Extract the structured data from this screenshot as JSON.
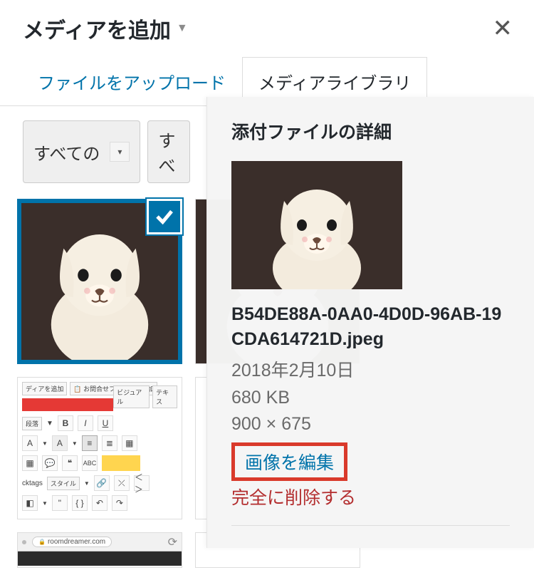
{
  "header": {
    "title": "メディアを追加"
  },
  "tabs": {
    "upload": "ファイルをアップロード",
    "library": "メディアライブラリ"
  },
  "toolbar": {
    "filter_all": "すべての",
    "filter_all2": "すべ"
  },
  "panel": {
    "heading": "添付ファイルの詳細",
    "filename": "B54DE88A-0AA0-4D0D-96AB-19CDA614721D.jpeg",
    "date": "2018年2月10日",
    "size": "680 KB",
    "dimensions": "900 × 675",
    "edit": "画像を編集",
    "delete": "完全に削除する"
  },
  "thumbs": {
    "editor_btn1": "ディアを追加",
    "editor_btn2": "お問合せフォームを追加",
    "editor_tab1": "ビジュアル",
    "editor_tab2": "テキス",
    "editor_style": "段落",
    "editor_style2": "スタイル",
    "editor_ktags": "cktags",
    "browser_url": "roomdreamer.com"
  }
}
